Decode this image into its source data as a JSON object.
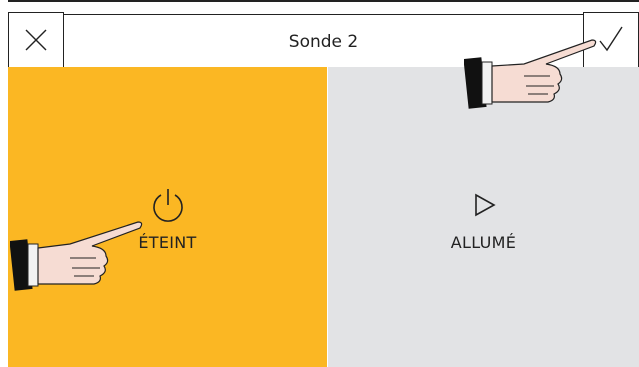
{
  "header": {
    "title": "Sonde 2",
    "close_icon": "close-icon",
    "confirm_icon": "check-icon"
  },
  "options": [
    {
      "label": "ÉTEINT",
      "icon": "power-icon",
      "selected": true,
      "color": "#fbb723"
    },
    {
      "label": "ALLUMÉ",
      "icon": "play-icon",
      "selected": false,
      "color": "#e2e3e5"
    }
  ],
  "annotations": {
    "hand_icon": "pointing-hand-icon"
  }
}
